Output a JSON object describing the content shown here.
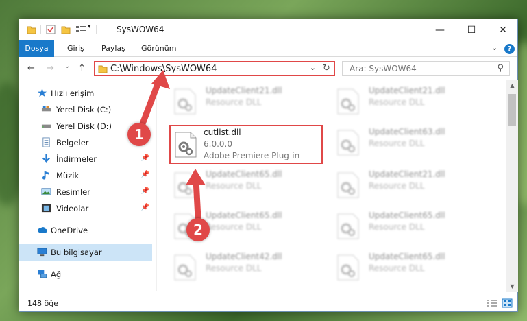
{
  "window": {
    "title": "SysWOW64",
    "minimize_glyph": "—",
    "maximize_glyph": "☐",
    "close_glyph": "✕"
  },
  "ribbon": {
    "tabs": [
      {
        "label": "Dosya",
        "active": true
      },
      {
        "label": "Giriş",
        "active": false
      },
      {
        "label": "Paylaş",
        "active": false
      },
      {
        "label": "Görünüm",
        "active": false
      }
    ],
    "collapse_glyph": "⌄",
    "help_glyph": "?"
  },
  "nav": {
    "back_glyph": "←",
    "forward_glyph": "→",
    "recent_glyph": "⌄",
    "up_glyph": "↑"
  },
  "address": {
    "path": "C:\\Windows\\SysWOW64",
    "dropdown_glyph": "⌄",
    "refresh_glyph": "↻"
  },
  "search": {
    "placeholder": "Ara: SysWOW64",
    "icon_glyph": "⚲"
  },
  "sidebar": {
    "items": [
      {
        "label": "Hızlı erişim",
        "icon": "star-icon"
      },
      {
        "label": "Yerel Disk (C:)",
        "icon": "drive-icon"
      },
      {
        "label": "Yerel Disk (D:)",
        "icon": "drive-icon"
      },
      {
        "label": "Belgeler",
        "icon": "document-icon",
        "pinned": true
      },
      {
        "label": "İndirmeler",
        "icon": "download-icon",
        "pinned": true
      },
      {
        "label": "Müzik",
        "icon": "music-icon",
        "pinned": true
      },
      {
        "label": "Resimler",
        "icon": "picture-icon",
        "pinned": true
      },
      {
        "label": "Videolar",
        "icon": "video-icon",
        "pinned": true
      },
      {
        "label": "OneDrive",
        "icon": "cloud-icon"
      },
      {
        "label": "Bu bilgisayar",
        "icon": "computer-icon",
        "selected": true
      },
      {
        "label": "Ağ",
        "icon": "network-icon"
      }
    ],
    "pin_glyph": "📌"
  },
  "files": [
    {
      "name": "UpdateClient21.dll",
      "desc": "Resource DLL"
    },
    {
      "name": "UpdateClient21.dll",
      "desc": "Resource DLL"
    },
    {
      "name": "cutlist.dll",
      "version": "6.0.0.0",
      "desc": "Adobe Premiere Plug-in"
    },
    {
      "name": "UpdateClient63.dll",
      "desc": "Resource DLL"
    },
    {
      "name": "UpdateClient65.dll",
      "desc": "Resource DLL"
    },
    {
      "name": "UpdateClient21.dll",
      "desc": "Resource DLL"
    },
    {
      "name": "UpdateClient65.dll",
      "desc": "Resource DLL"
    },
    {
      "name": "UpdateClient65.dll",
      "desc": "Resource DLL"
    },
    {
      "name": "UpdateClient42.dll",
      "desc": "Resource DLL"
    },
    {
      "name": "UpdateClient65.dll",
      "desc": "Resource DLL"
    }
  ],
  "status": {
    "count": "148 öğe"
  },
  "annotations": {
    "badge1": "1",
    "badge2": "2"
  },
  "colors": {
    "accent": "#1979ca",
    "highlight": "#e04848",
    "selected": "#cce4f7"
  }
}
